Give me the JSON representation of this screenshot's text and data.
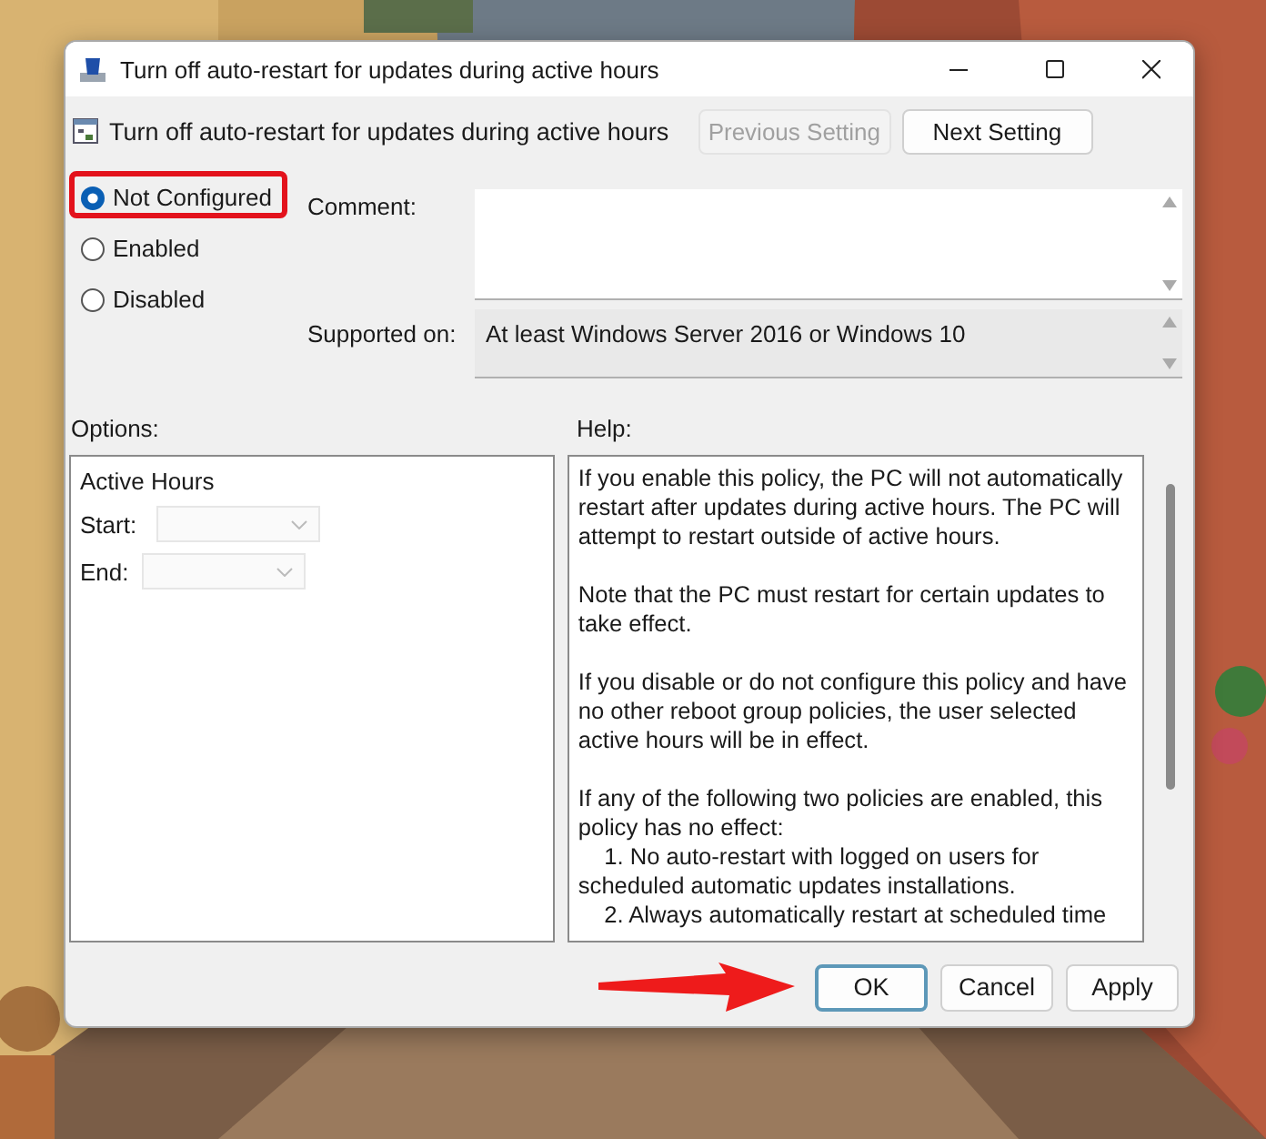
{
  "window": {
    "title": "Turn off auto-restart for updates during active hours"
  },
  "policy": {
    "title": "Turn off auto-restart for updates during active hours"
  },
  "navigation": [
    {
      "label": "Previous Setting",
      "disabled": true
    },
    {
      "label": "Next Setting",
      "disabled": false
    }
  ],
  "states": [
    {
      "label": "Not Configured",
      "selected": true,
      "highlighted": true
    },
    {
      "label": "Enabled",
      "selected": false,
      "highlighted": false
    },
    {
      "label": "Disabled",
      "selected": false,
      "highlighted": false
    }
  ],
  "comment": {
    "label": "Comment:"
  },
  "supported_on": {
    "label": "Supported on:",
    "value": "At least Windows Server 2016 or Windows 10"
  },
  "options": {
    "label": "Options:",
    "group": "Active Hours",
    "fields": [
      {
        "label": "Start:",
        "disabled": true
      },
      {
        "label": "End:",
        "disabled": true
      }
    ]
  },
  "help": {
    "label": "Help:",
    "paragraphs": [
      "If you enable this policy, the PC will not automatically restart after updates during active hours. The PC will attempt to restart outside of active hours.",
      "Note that the PC must restart for certain updates to take effect.",
      "If you disable or do not configure this policy and have no other reboot group policies, the user selected active hours will be in effect.",
      "If any of the following two policies are enabled, this policy has no effect:",
      "    1. No auto-restart with logged on users for scheduled automatic updates installations.",
      "    2. Always automatically restart at scheduled time"
    ]
  },
  "buttons": [
    {
      "label": "OK",
      "default": true,
      "pointed_at": true
    },
    {
      "label": "Cancel",
      "default": false,
      "pointed_at": false
    },
    {
      "label": "Apply",
      "default": false,
      "pointed_at": false
    }
  ]
}
